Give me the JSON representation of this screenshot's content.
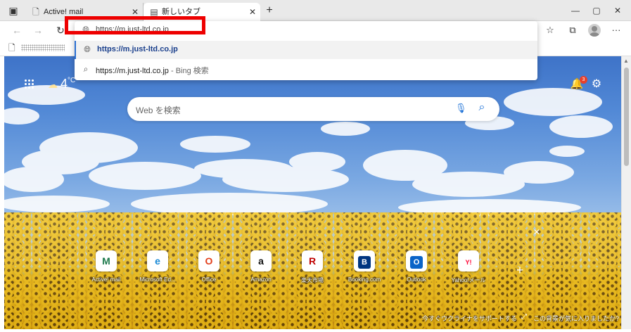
{
  "tabs": [
    {
      "label": "Active! mail",
      "favicon": "page-icon"
    },
    {
      "label": "新しいタブ",
      "favicon": "newtab-icon"
    }
  ],
  "window": {
    "minimize": "—",
    "maximize": "▢",
    "close": "✕"
  },
  "toolbar": {
    "back": "←",
    "forward": "→",
    "refresh": "↻",
    "favorites_icon": "☆",
    "collections_icon": "⧉",
    "more_icon": "···"
  },
  "address": {
    "value": "https://m.just-ltd.co.jp"
  },
  "suggestions": [
    {
      "text": "https://m.just-ltd.co.jp",
      "icon": "globe-icon"
    },
    {
      "text": "https://m.just-ltd.co.jp",
      "suffix": " - Bing 検索",
      "icon": "search-icon"
    }
  ],
  "ntp": {
    "weather_temp": "4",
    "weather_unit": "°C",
    "notification_count": "3",
    "search_placeholder": "Web を検索",
    "tiles": [
      {
        "label": "Active! mail",
        "glyph": "M",
        "color": "#1e7a4c"
      },
      {
        "label": "Microsoft Ed...",
        "glyph": "e",
        "color": "#1a8ad6"
      },
      {
        "label": "Office",
        "glyph": "O",
        "color": "#e2401c"
      },
      {
        "label": "Amazon",
        "glyph": "a",
        "color": "#111111"
      },
      {
        "label": "楽天市場",
        "glyph": "R",
        "color": "#bf0000"
      },
      {
        "label": "Booking.com",
        "glyph": "B",
        "color": "#003580"
      },
      {
        "label": "Outlook",
        "glyph": "O",
        "color": "#0a64c8"
      },
      {
        "label": "Yahoo!メール",
        "glyph": "Y!",
        "color": "#ff0033"
      }
    ],
    "footer_left": "今すぐウクライナをサポートする",
    "footer_right": "この背景が気に入りましたか?"
  },
  "colors": {
    "accent": "#1a6fd6",
    "highlight": "#ee0000",
    "selection_bar": "#2a6fd2"
  }
}
